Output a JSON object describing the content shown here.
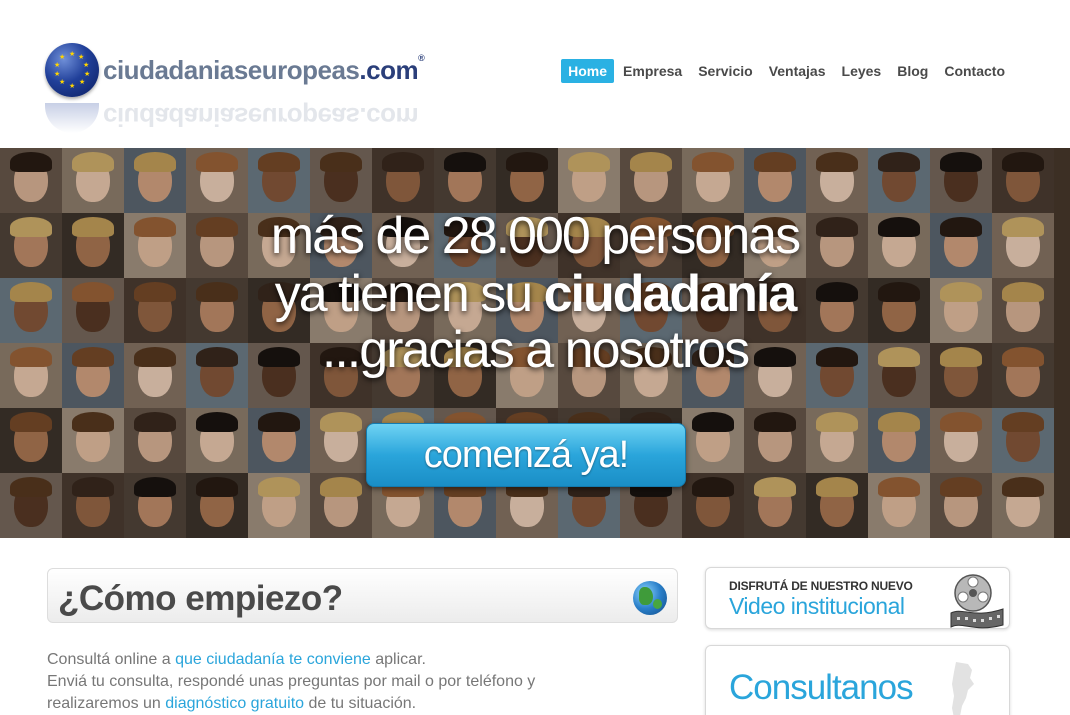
{
  "header": {
    "logo_text": "ciudadaniaseuropeas",
    "logo_domain": ".com",
    "logo_mark": "®",
    "nav": [
      {
        "label": "Home",
        "active": true
      },
      {
        "label": "Empresa"
      },
      {
        "label": "Servicio"
      },
      {
        "label": "Ventajas"
      },
      {
        "label": "Leyes"
      },
      {
        "label": "Blog"
      },
      {
        "label": "Contacto"
      }
    ]
  },
  "hero": {
    "line1": "más de 28.000 personas",
    "line2_prefix": "ya tienen su ",
    "line2_bold": "ciudadanía",
    "line3": "...gracias a nosotros",
    "cta_label": "comenzá ya!"
  },
  "main": {
    "section_title": "¿Cómo empiezo?",
    "p1_before": "Consultá online a ",
    "p1_link": "que ciudadanía te conviene",
    "p1_after": " aplicar.",
    "p2": "Enviá tu consulta, respondé unas preguntas por mail o por teléfono y",
    "p3_before": "realizaremos un ",
    "p3_link": "diagnóstico gratuito",
    "p3_after": " de tu situación."
  },
  "sidebar": {
    "video_kicker": "DISFRUTÁ DE NUESTRO NUEVO",
    "video_title": "Video institucional",
    "consult_title": "Consultanos"
  },
  "icons": {
    "logo_globe": "eu-globe-icon",
    "earth": "earth-globe-icon",
    "film": "film-reel-icon",
    "map": "argentina-map-icon"
  },
  "colors": {
    "accent": "#2ab1e3",
    "link": "#2aa5db",
    "logo_dark": "#2b3f7a",
    "logo_grey": "#6a7a93"
  }
}
